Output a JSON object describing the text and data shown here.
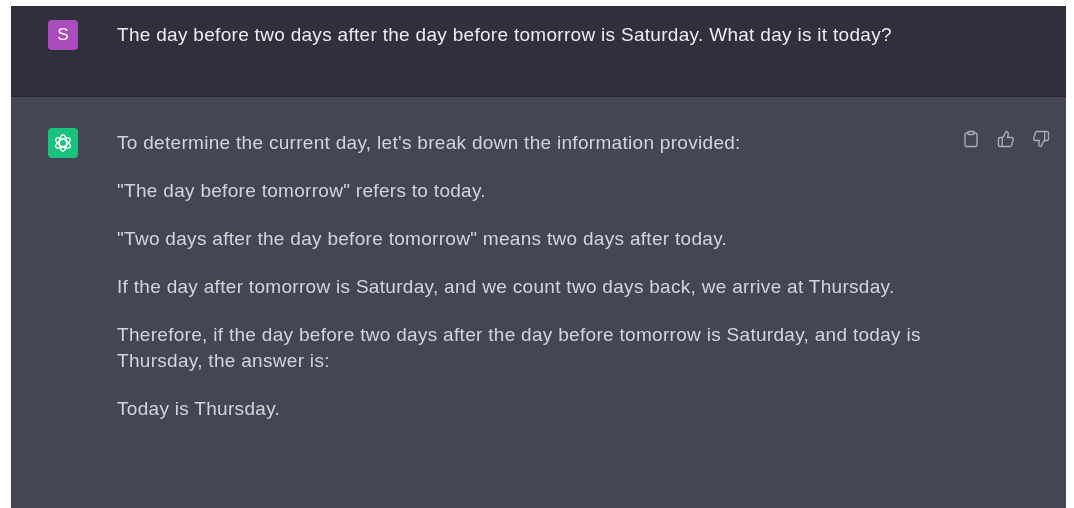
{
  "messages": [
    {
      "kind": "user",
      "avatar": "S",
      "paragraphs": [
        "The day before two days after the day before tomorrow is Saturday. What day is it today?"
      ]
    },
    {
      "kind": "assistant",
      "actions": [
        {
          "kind": "copy"
        },
        {
          "kind": "like"
        },
        {
          "kind": "dislike"
        }
      ],
      "paragraphs": [
        "To determine the current day, let's break down the information provided:",
        "\"The day before tomorrow\" refers to today.",
        "\"Two days after the day before tomorrow\" means two days after today.",
        "If the day after tomorrow is Saturday, and we count two days back, we arrive at Thursday.",
        "Therefore, if the day before two days after the day before tomorrow is Saturday, and today is Thursday, the answer is:",
        "Today is Thursday."
      ]
    }
  ]
}
